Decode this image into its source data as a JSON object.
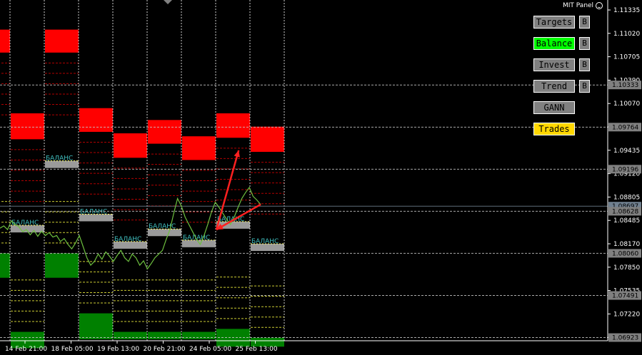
{
  "panel": {
    "title": "MIT Panel",
    "icon": "smiley-icon",
    "buttons": [
      {
        "label": "Targets",
        "color": "#808080",
        "side_label": "B"
      },
      {
        "label": "Balance",
        "color": "#00ff00",
        "side_label": "B"
      },
      {
        "label": "Invest",
        "color": "#808080",
        "side_label": "B"
      },
      {
        "label": "Trend",
        "color": "#808080",
        "side_label": "B"
      },
      {
        "label": "GANN",
        "color": "#808080",
        "side_label": ""
      },
      {
        "label": "Trades",
        "color": "#ffd700",
        "side_label": ""
      }
    ]
  },
  "box_label": "БАЛАНС",
  "chart_data": {
    "type": "line",
    "title": "",
    "price_axis_ticks": [
      "1.11335",
      "1.11020",
      "1.10705",
      "1.10390",
      "1.10070",
      "1.09755",
      "1.09435",
      "1.09120",
      "1.08805",
      "1.08485",
      "1.08170",
      "1.07850",
      "1.07535",
      "1.07220",
      "1.06900"
    ],
    "price_tags": [
      "1.10333",
      "1.09764",
      "1.09196",
      "1.08697",
      "1.08628",
      "1.08060",
      "1.07491",
      "1.06923"
    ],
    "time_axis_labels": [
      "14 Feb 21:00",
      "18 Feb 05:00",
      "19 Feb 13:00",
      "20 Feb 21:00",
      "24 Feb 05:00",
      "25 Feb 13:00"
    ],
    "ylim": [
      1.0688,
      1.1148
    ],
    "periods": [
      {
        "red": [
          1.1108,
          1.1077
        ],
        "green": [
          1.0806,
          1.0773
        ]
      },
      {
        "red": [
          1.0995,
          1.096
        ],
        "green": [
          1.07,
          1.0678
        ],
        "balance": 1.084
      },
      {
        "red": [
          1.1108,
          1.1077
        ],
        "green": [
          1.0806,
          1.0773
        ],
        "balance": 1.0927
      },
      {
        "red": [
          1.1002,
          1.097
        ],
        "green": [
          1.0725,
          1.069
        ],
        "balance": 1.0855
      },
      {
        "red": [
          1.0968,
          1.0935
        ],
        "green": [
          1.07,
          1.069
        ],
        "balance": 1.0818
      },
      {
        "red": [
          1.0986,
          1.0954
        ],
        "green": [
          1.07,
          1.069
        ],
        "balance": 1.0835
      },
      {
        "red": [
          1.0964,
          1.0932
        ],
        "green": [
          1.07,
          1.069
        ],
        "balance": 1.082
      },
      {
        "red": [
          1.0995,
          1.0962
        ],
        "green": [
          1.0704,
          1.068
        ],
        "balance": 1.0845
      },
      {
        "red": [
          1.0977,
          1.0943
        ],
        "green": [
          1.0692,
          1.068
        ],
        "balance": 1.0815
      }
    ],
    "price_series": [
      1.084,
      1.0843,
      1.0838,
      1.085,
      1.0845,
      1.0842,
      1.0835,
      1.0838,
      1.0831,
      1.0837,
      1.0829,
      1.0836,
      1.083,
      1.0834,
      1.0828,
      1.083,
      1.0822,
      1.0826,
      1.0818,
      1.0812,
      1.082,
      1.083,
      1.0815,
      1.08,
      1.079,
      1.0795,
      1.0805,
      1.0798,
      1.0808,
      1.0802,
      1.0795,
      1.0803,
      1.081,
      1.08,
      1.0795,
      1.0805,
      1.08,
      1.079,
      1.0796,
      1.0785,
      1.0792,
      1.08,
      1.0805,
      1.081,
      1.0825,
      1.0838,
      1.086,
      1.088,
      1.087,
      1.0855,
      1.0845,
      1.0835,
      1.0825,
      1.0818,
      1.083,
      1.0845,
      1.0862,
      1.0875,
      1.0868,
      1.086,
      1.0852,
      1.0845,
      1.0855,
      1.0868,
      1.088,
      1.0888,
      1.0895,
      1.0883,
      1.0878,
      1.0872
    ],
    "arrows": [
      {
        "from": [
          1.0872,
          "p6.3"
        ],
        "to": [
          1.0838,
          "p7.0"
        ]
      },
      {
        "from": [
          1.0838,
          "p7.0"
        ],
        "to": [
          1.0945,
          "p7.65"
        ]
      }
    ]
  }
}
